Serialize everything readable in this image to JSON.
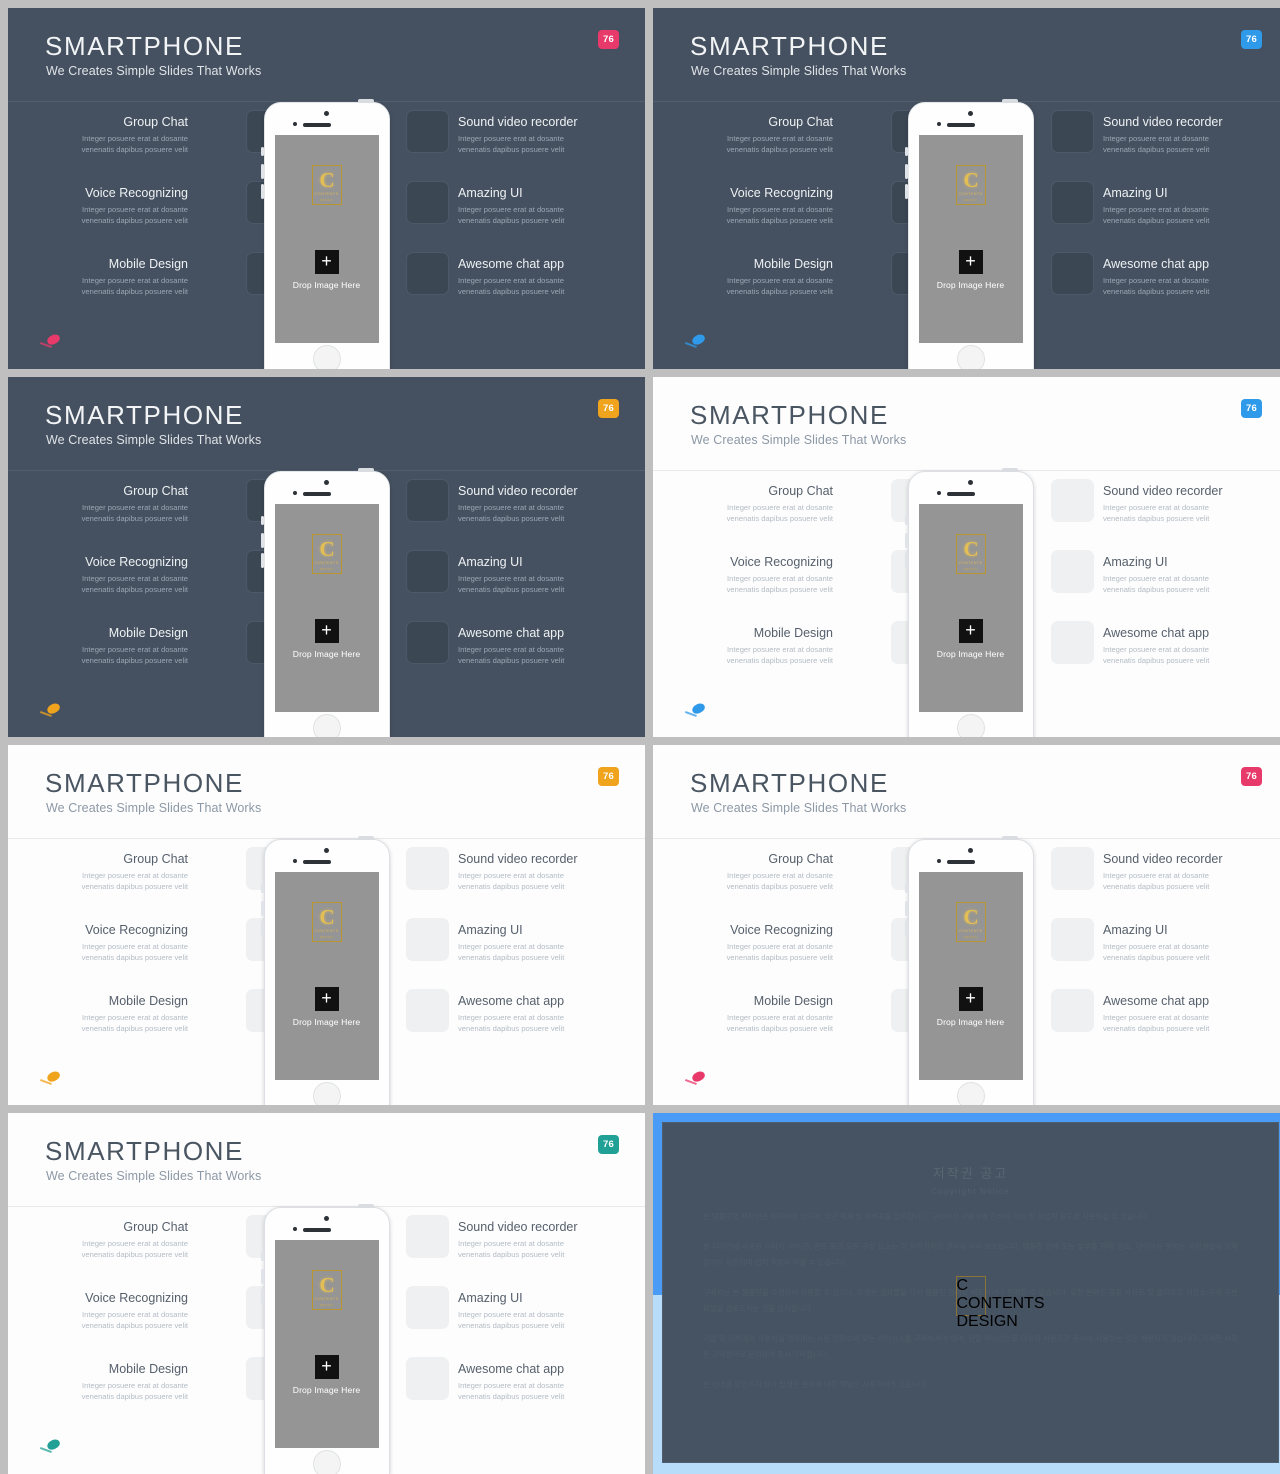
{
  "deck": {
    "slide_title": "SMARTPHONE",
    "slide_subtitle": "We Creates Simple Slides That Works",
    "badge_label": "76",
    "phone": {
      "plus_label": "+",
      "drop_label": "Drop Image Here",
      "logo_letter": "C",
      "logo_line2": "CONTENTS",
      "logo_line3": "DESIGN"
    },
    "features_left": [
      {
        "title": "Group Chat",
        "desc_line1": "Integer posuere erat at  dosante",
        "desc_line2": "venenatis dapibus posuere velit"
      },
      {
        "title": "Voice Recognizing",
        "desc_line1": "Integer posuere erat at  dosante",
        "desc_line2": "venenatis dapibus posuere velit"
      },
      {
        "title": "Mobile Design",
        "desc_line1": "Integer posuere erat at  dosante",
        "desc_line2": "venenatis dapibus posuere velit"
      }
    ],
    "features_right": [
      {
        "title": "Sound video recorder",
        "desc_line1": "Integer posuere erat at  dosante",
        "desc_line2": "venenatis dapibus posuere velit"
      },
      {
        "title": "Amazing UI",
        "desc_line1": "Integer posuere erat at  dosante",
        "desc_line2": "venenatis dapibus posuere velit"
      },
      {
        "title": "Awesome chat app",
        "desc_line1": "Integer posuere erat at  dosante",
        "desc_line2": "venenatis dapibus posuere velit"
      }
    ],
    "slides": [
      {
        "id": "slide-1",
        "theme": "dark",
        "badge_color": "#e8396b",
        "pin_color": "#e8396b"
      },
      {
        "id": "slide-2",
        "theme": "dark",
        "badge_color": "#2f9aea",
        "pin_color": "#2f9aea"
      },
      {
        "id": "slide-3",
        "theme": "dark",
        "badge_color": "#f0a31c",
        "pin_color": "#f0a31c"
      },
      {
        "id": "slide-4",
        "theme": "light",
        "badge_color": "#2f9aea",
        "pin_color": "#2f9aea"
      },
      {
        "id": "slide-5",
        "theme": "light",
        "badge_color": "#f0a31c",
        "pin_color": "#f0a31c"
      },
      {
        "id": "slide-6",
        "theme": "light",
        "badge_color": "#e8396b",
        "pin_color": "#e8396b"
      },
      {
        "id": "slide-7",
        "theme": "light",
        "badge_color": "#21a195",
        "pin_color": "#21a195"
      }
    ],
    "copyright": {
      "heading_ko": "저작권 공고",
      "heading_en": "Copyright Notice",
      "paragraphs": [
        "본 템플릿의 저작권은 제작사에 있으며, 무단 복제 및 재배포를 금지합니다. 구매하신 사용자에 한하여 개인 및 상업적 용도로 사용하실 수 있습니다.",
        "본 디자인에 사용된 이미지, 아이콘, 폰트 등의 모든 구성 요소는 각 저작권자의 권리에 따라 보호됩니다. 템플릿 전체 또는 일부를 판매, 양도, 대여하는 행위는 저작권법에 의해 엄격히 제한되며 법적 책임이 따를 수 있습니다.",
        "구매자는 본 템플릿을 수정하여 사용할 수 있으나, 수정된 결과물을 다시 템플릿 형태로 배포하거나 판매할 수 없습니다. 또한 온라인 공유 사이트 및 클라우드 저장소 등에 원본 파일을 업로드하는 것을 금지합니다.",
        "기업 및 단체에서 사용하실 경우에는 사용 인원수에 맞는 라이선스를 구매하셔야 하며, 단일 라이선스로 다수의 사용자가 동시에 사용하는 것은 허용되지 않습니다. 자세한 사항은 고객센터로 문의하여 주시기 바랍니다.",
        "본 안내를 확인하지 않아 발생한 문제에 대한 책임은 사용자에게 있습니다."
      ],
      "logo_letter": "C"
    }
  }
}
